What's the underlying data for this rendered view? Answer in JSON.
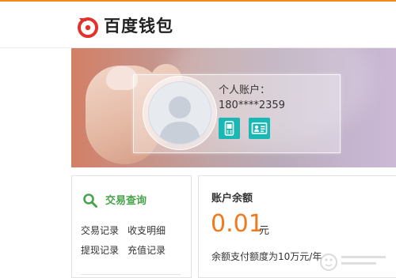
{
  "brand": {
    "name": "百度钱包",
    "accent_color": "#f08a1c",
    "logo_color": "#e2322b",
    "logo_icon": "baidu-wallet-logo-icon"
  },
  "account": {
    "title": "个人账户：",
    "number": "180****2359",
    "avatar_icon": "default-avatar-icon",
    "action_icons": [
      "phone-icon",
      "id-card-icon"
    ],
    "icon_color": "#1ab8b5"
  },
  "query": {
    "title": "交易查询",
    "icon": "search-icon",
    "title_color": "#49a34a",
    "links": [
      "交易记录",
      "收支明细",
      "提现记录",
      "充值记录"
    ]
  },
  "balance": {
    "title": "账户余额",
    "amount": "0.01",
    "unit": "元",
    "amount_color": "#f07a1c",
    "quota_text": "余额支付额度为10万元/年"
  }
}
